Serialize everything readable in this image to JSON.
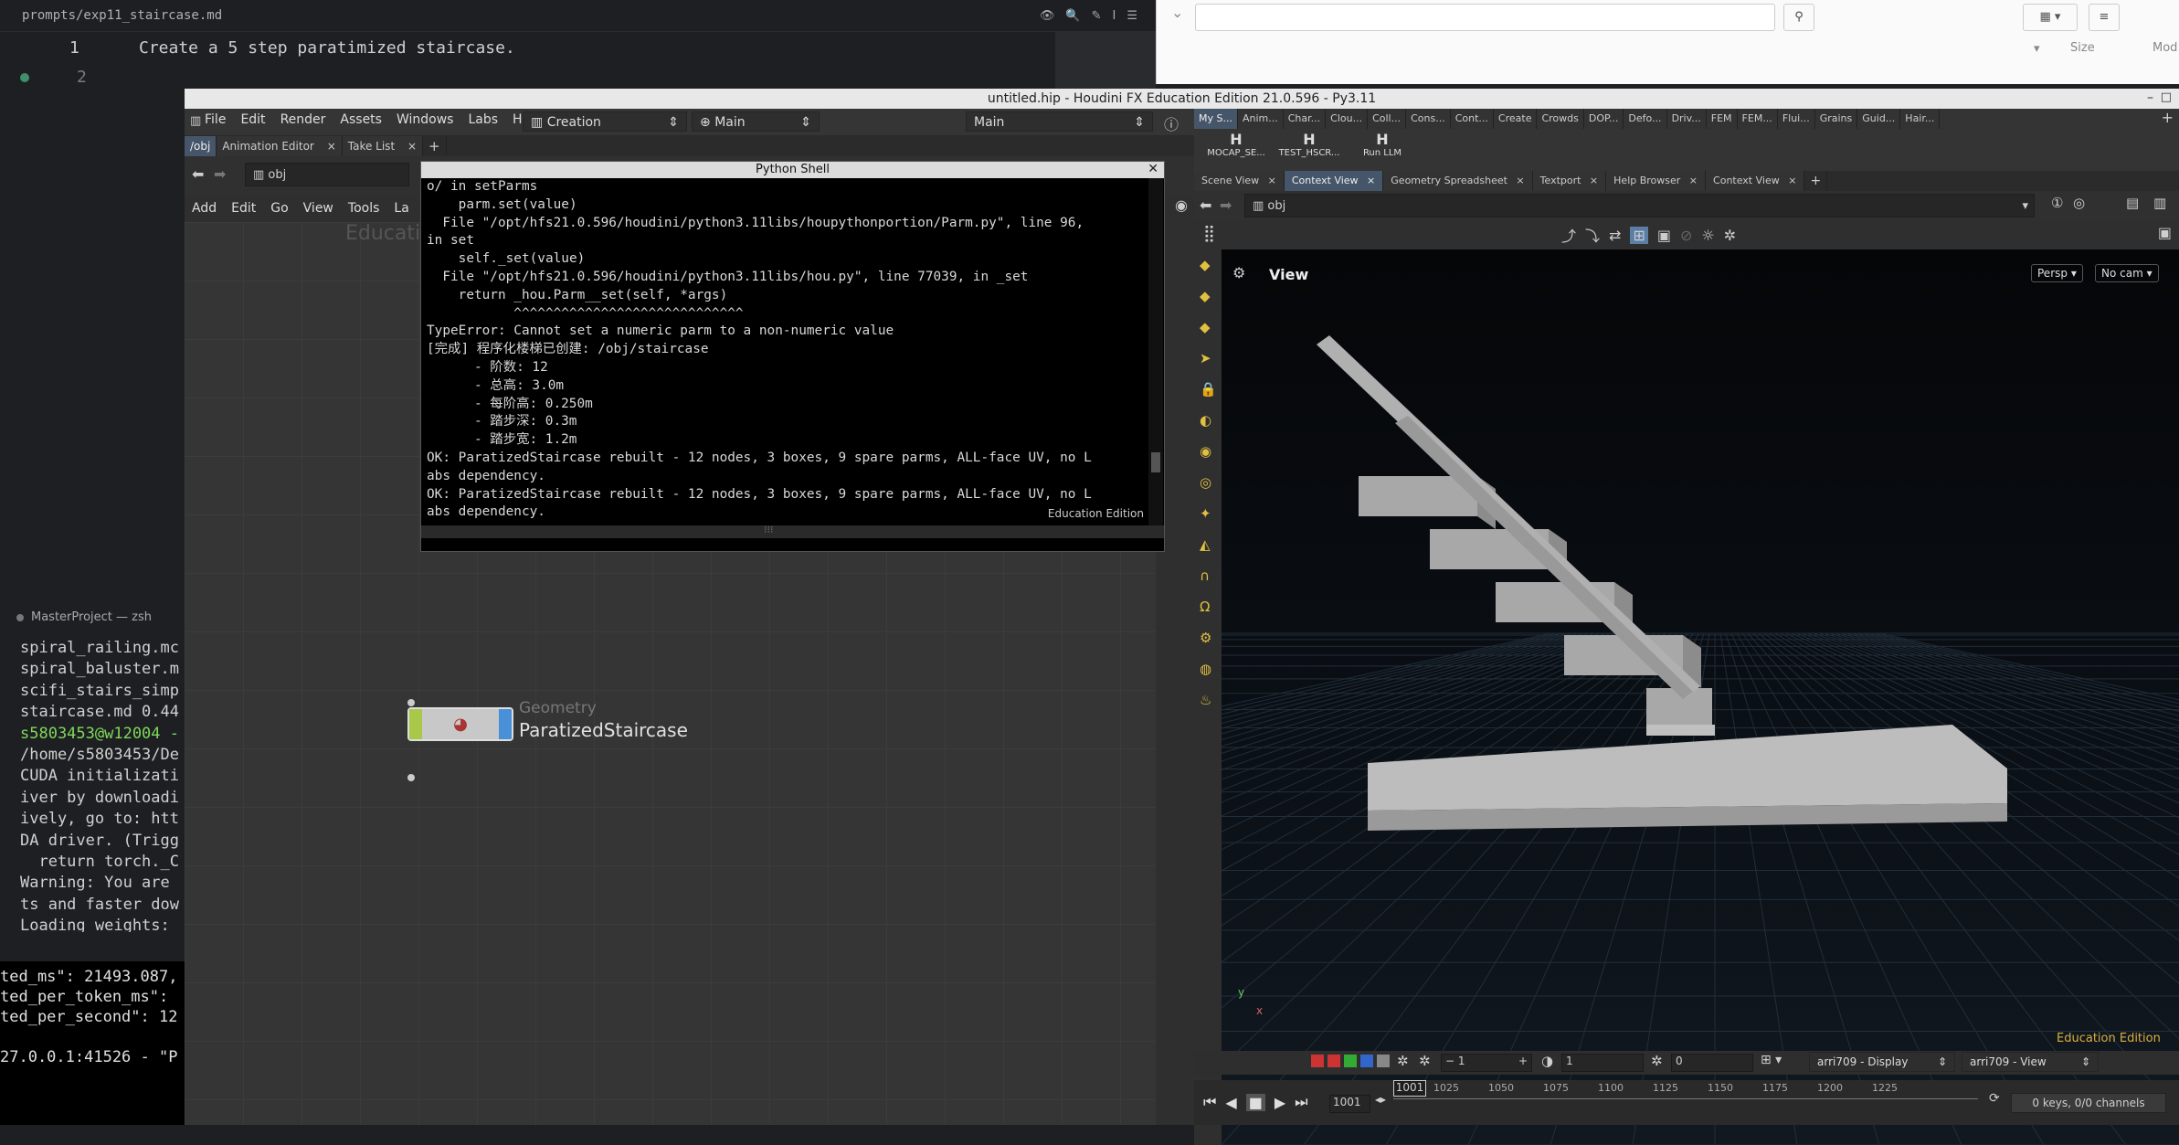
{
  "editor": {
    "path": "prompts/exp11_staircase.md",
    "lines": [
      {
        "num": "1",
        "text": "Create a 5 step paratimized staircase."
      },
      {
        "num": "2",
        "text": ""
      }
    ]
  },
  "terminal": {
    "title": "MasterProject — zsh",
    "lines": [
      "spiral_railing.mc",
      "spiral_baluster.m",
      "scifi_stairs_simp",
      "staircase.md 0.44",
      "s5803453@w12004 -",
      "/home/s5803453/De",
      "CUDA initializati",
      "iver by downloadi",
      "ively, go to: htt",
      "DA driver. (Trigg",
      "  return torch._C",
      "Warning: You are ",
      "ts and faster dow",
      "Loading weights: "
    ],
    "bottom_lines": [
      "ted_ms\": 21493.087,",
      "ted_per_token_ms\":",
      "ted_per_second\": 12",
      "",
      "27.0.0.1:41526 - \"P"
    ]
  },
  "houdini": {
    "window_title": "untitled.hip - Houdini FX Education Edition 21.0.596 - Py3.11",
    "menu": [
      "File",
      "Edit",
      "Render",
      "Assets",
      "Windows",
      "Labs",
      "Help"
    ],
    "desktop": "Creation",
    "main_left": "Main",
    "main_right": "Main",
    "net_tabs": [
      "/obj",
      "Animation Editor",
      "Take List"
    ],
    "net_path": "obj",
    "net_menu": [
      "Add",
      "Edit",
      "Go",
      "View",
      "Tools",
      "La"
    ],
    "watermark": "Educati",
    "node": {
      "type": "Geometry",
      "name": "ParatizedStaircase"
    },
    "shelf_tabs": [
      "My S...",
      "Anim...",
      "Char...",
      "Clou...",
      "Coll...",
      "Cons...",
      "Cont...",
      "Create",
      "Crowds",
      "DOP...",
      "Defo...",
      "Driv...",
      "FEM",
      "FEM...",
      "Flui...",
      "Grains",
      "Guid...",
      "Hair..."
    ],
    "shelf_tools": [
      "MOCAP_SE...",
      "TEST_HSCR...",
      "Run LLM"
    ],
    "scene_tabs": [
      "Scene View",
      "Context View",
      "Geometry Spreadsheet",
      "Textport",
      "Help Browser",
      "Context View"
    ],
    "scene_path": "obj",
    "viewport": {
      "label": "View",
      "persp": "Persp",
      "cam": "No cam",
      "edition": "Education Edition",
      "axis_y": "y",
      "axis_x": "x"
    },
    "timeline": {
      "frame": "1",
      "step": "1",
      "value": "0",
      "display": "arri709 - Display",
      "view": "arri709 - View",
      "ticks": [
        "1025",
        "1050",
        "1075",
        "1100",
        "1125",
        "1150",
        "1175",
        "1200",
        "1225"
      ],
      "current": "1001",
      "cursor": "1001",
      "keys": "0 keys, 0/0 channels"
    }
  },
  "python_shell": {
    "title": "Python Shell",
    "lines": [
      "o/ in setParms",
      "    parm.set(value)",
      "  File \"/opt/hfs21.0.596/houdini/python3.11libs/houpythonportion/Parm.py\", line 96,",
      "in set",
      "    self._set(value)",
      "  File \"/opt/hfs21.0.596/houdini/python3.11libs/hou.py\", line 77039, in _set",
      "    return _hou.Parm__set(self, *args)",
      "           ^^^^^^^^^^^^^^^^^^^^^^^^^^^^^",
      "TypeError: Cannot set a numeric parm to a non-numeric value",
      "[完成] 程序化楼梯已创建: /obj/staircase",
      "      - 阶数: 12",
      "      - 总高: 3.0m",
      "      - 每阶高: 0.250m",
      "      - 踏步深: 0.3m",
      "      - 踏步宽: 1.2m",
      "OK: ParatizedStaircase rebuilt - 12 nodes, 3 boxes, 9 spare parms, ALL-face UV, no L",
      "abs dependency.",
      "OK: ParatizedStaircase rebuilt - 12 nodes, 3 boxes, 9 spare parms, ALL-face UV, no L",
      "abs dependency."
    ],
    "footer": "Education Edition"
  },
  "browser": {
    "size_label": "Size",
    "mod_label": "Mod"
  }
}
